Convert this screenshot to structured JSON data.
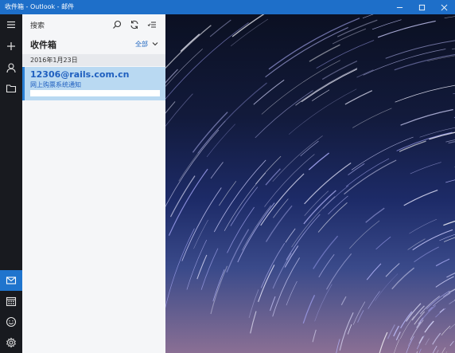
{
  "window": {
    "title": "收件箱 - Outlook - 邮件",
    "minimize_label": "—",
    "maximize_label": "☐",
    "close_label": "✕"
  },
  "search": {
    "placeholder": "搜索"
  },
  "folder": {
    "name": "收件箱",
    "filter_label": "全部"
  },
  "messages": {
    "date_header": "2016年1月23日",
    "items": [
      {
        "sender": "12306@rails.com.cn",
        "subject": "网上购票系统通知"
      }
    ]
  },
  "rail": {
    "icons": [
      "hamburger-icon",
      "new-mail-icon",
      "account-icon",
      "folder-icon",
      "mail-icon",
      "calendar-icon",
      "feedback-icon",
      "settings-icon"
    ],
    "active": "mail-icon"
  },
  "colors": {
    "titlebar": "#1e6fc9",
    "accent": "#1f74cd",
    "selected_item": "#b9d9f2",
    "rail": "#181a1f"
  }
}
